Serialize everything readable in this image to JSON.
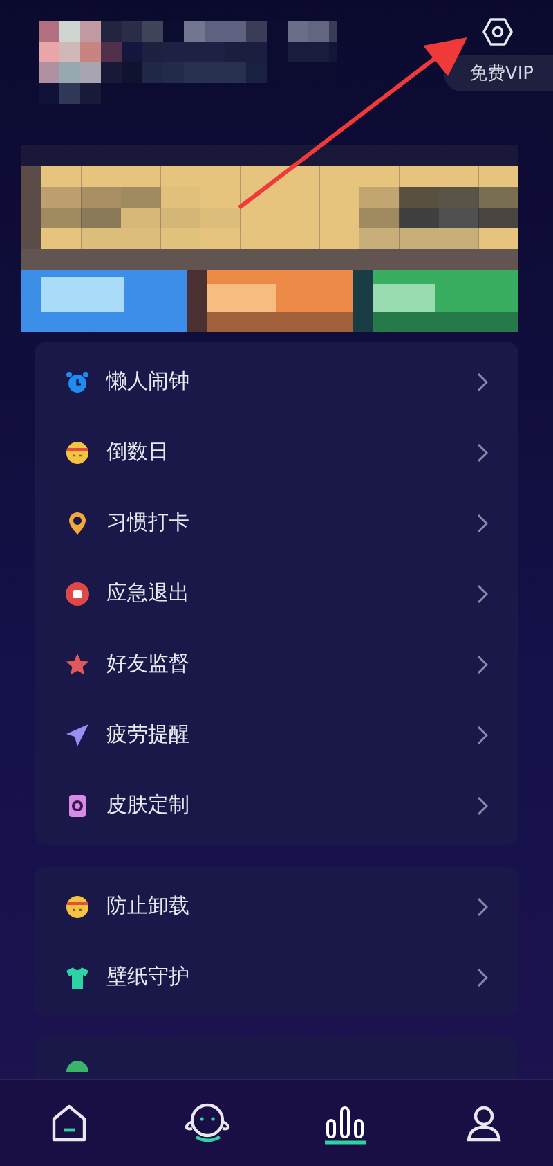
{
  "header": {
    "vip_button": "免费VIP"
  },
  "groups": [
    {
      "items": [
        {
          "label": "懒人闹钟",
          "kind": "alarm"
        },
        {
          "label": "倒数日",
          "kind": "face"
        },
        {
          "label": "习惯打卡",
          "kind": "pin"
        },
        {
          "label": "应急退出",
          "kind": "stop"
        },
        {
          "label": "好友监督",
          "kind": "star"
        },
        {
          "label": "疲劳提醒",
          "kind": "plane"
        },
        {
          "label": "皮肤定制",
          "kind": "skin"
        }
      ]
    },
    {
      "items": [
        {
          "label": "防止卸载",
          "kind": "face"
        },
        {
          "label": "壁纸守护",
          "kind": "shirt"
        }
      ]
    },
    {
      "items": [
        {
          "kind": "dot"
        }
      ]
    }
  ],
  "nav": [
    {
      "kind": "home",
      "selected": false
    },
    {
      "kind": "planet",
      "selected": false
    },
    {
      "kind": "stats",
      "selected": true
    },
    {
      "kind": "profile",
      "selected": false
    }
  ]
}
